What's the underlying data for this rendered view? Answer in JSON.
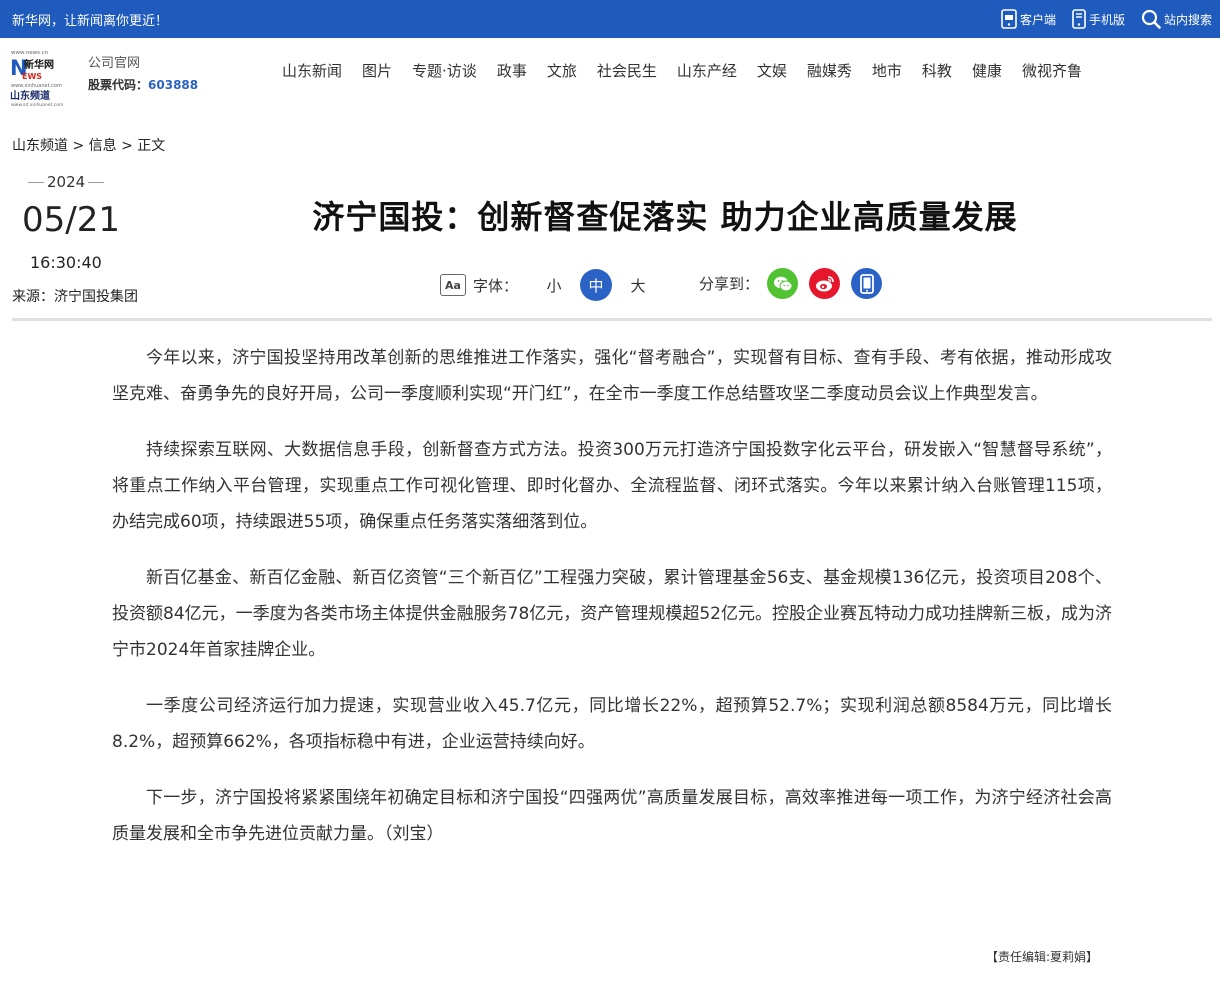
{
  "topbar": {
    "slogan": "新华网，让新闻离你更近！",
    "tools": [
      {
        "label": "客户端",
        "icon": "app-client-icon"
      },
      {
        "label": "手机版",
        "icon": "mobile-icon"
      },
      {
        "label": "站内搜索",
        "icon": "search-icon"
      }
    ]
  },
  "header": {
    "logo_top": "新华网",
    "logo_sub": "山东频道",
    "official_label": "公司官网",
    "stock_label": "股票代码：",
    "stock_code": "603888",
    "nav": [
      "山东新闻",
      "图片",
      "专题·访谈",
      "政事",
      "文旅",
      "社会民生",
      "山东产经",
      "文娱",
      "融媒秀",
      "地市",
      "科教",
      "健康",
      "微视齐鲁"
    ]
  },
  "breadcrumb": {
    "items": [
      "山东频道",
      "信息",
      "正文"
    ],
    "separator": " > "
  },
  "meta": {
    "year": "2024",
    "month_day": "05/21",
    "time": "16:30:40",
    "source": "来源：济宁国投集团"
  },
  "article": {
    "title": "济宁国投：创新督查促落实 助力企业高质量发展",
    "fontsize_label": "字体：",
    "fontsize_options": [
      "小",
      "中",
      "大"
    ],
    "fontsize_active": "中",
    "share_label": "分享到：",
    "share_targets": [
      {
        "name": "wechat-icon",
        "color": "#51c332"
      },
      {
        "name": "weibo-icon",
        "color": "#e6162d"
      },
      {
        "name": "mobile-share-icon",
        "color": "#2a62c6"
      }
    ],
    "paragraphs": [
      "今年以来，济宁国投坚持用改革创新的思维推进工作落实，强化“督考融合”，实现督有目标、查有手段、考有依据，推动形成攻坚克难、奋勇争先的良好开局，公司一季度顺利实现“开门红”，在全市一季度工作总结暨攻坚二季度动员会议上作典型发言。",
      "持续探索互联网、大数据信息手段，创新督查方式方法。投资300万元打造济宁国投数字化云平台，研发嵌入“智慧督导系统”，将重点工作纳入平台管理，实现重点工作可视化管理、即时化督办、全流程监督、闭环式落实。今年以来累计纳入台账管理115项，办结完成60项，持续跟进55项，确保重点任务落实落细落到位。",
      "新百亿基金、新百亿金融、新百亿资管“三个新百亿”工程强力突破，累计管理基金56支、基金规模136亿元，投资项目208个、投资额84亿元，一季度为各类市场主体提供金融服务78亿元，资产管理规模超52亿元。控股企业赛瓦特动力成功挂牌新三板，成为济宁市2024年首家挂牌企业。",
      "一季度公司经济运行加力提速，实现营业收入45.7亿元，同比增长22%，超预算52.7%；实现利润总额8584万元，同比增长8.2%，超预算662%，各项指标稳中有进，企业运营持续向好。",
      "下一步，济宁国投将紧紧围绕年初确定目标和济宁国投“四强两优”高质量发展目标，高效率推进每一项工作，为济宁经济社会高质量发展和全市争先进位贡献力量。（刘宝）"
    ],
    "editor": "【责任编辑:夏莉娟】"
  }
}
